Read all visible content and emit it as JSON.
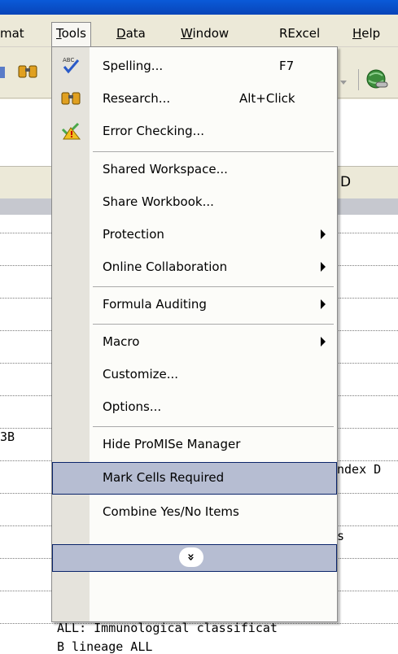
{
  "menubar": {
    "items": [
      {
        "label": "mat",
        "u": ""
      },
      {
        "label": "Tools",
        "u": "T"
      },
      {
        "label": "Data",
        "u": "D"
      },
      {
        "label": "Window",
        "u": "W"
      },
      {
        "label": "RExcel",
        "u": ""
      },
      {
        "label": "Help",
        "u": "H"
      }
    ]
  },
  "column_header": {
    "d": "D"
  },
  "cells": {
    "a_row9": "3B",
    "d_row10": "ndex D",
    "d_row12": "s",
    "row15": "ALL: Immunological classificat",
    "row16": "B lineage ALL"
  },
  "menu": {
    "items": [
      {
        "label": "Spelling...",
        "shortcut": "F7"
      },
      {
        "label": "Research...",
        "shortcut": "Alt+Click"
      },
      {
        "label": "Error Checking..."
      },
      {
        "label": "Shared Workspace..."
      },
      {
        "label": "Share Workbook..."
      },
      {
        "label": "Protection"
      },
      {
        "label": "Online Collaboration"
      },
      {
        "label": "Formula Auditing"
      },
      {
        "label": "Macro"
      },
      {
        "label": "Customize..."
      },
      {
        "label": "Options..."
      },
      {
        "label": "Hide ProMISe Manager"
      },
      {
        "label": "Mark Cells Required"
      },
      {
        "label": "Combine Yes/No Items"
      }
    ],
    "expand_glyph": "»"
  }
}
